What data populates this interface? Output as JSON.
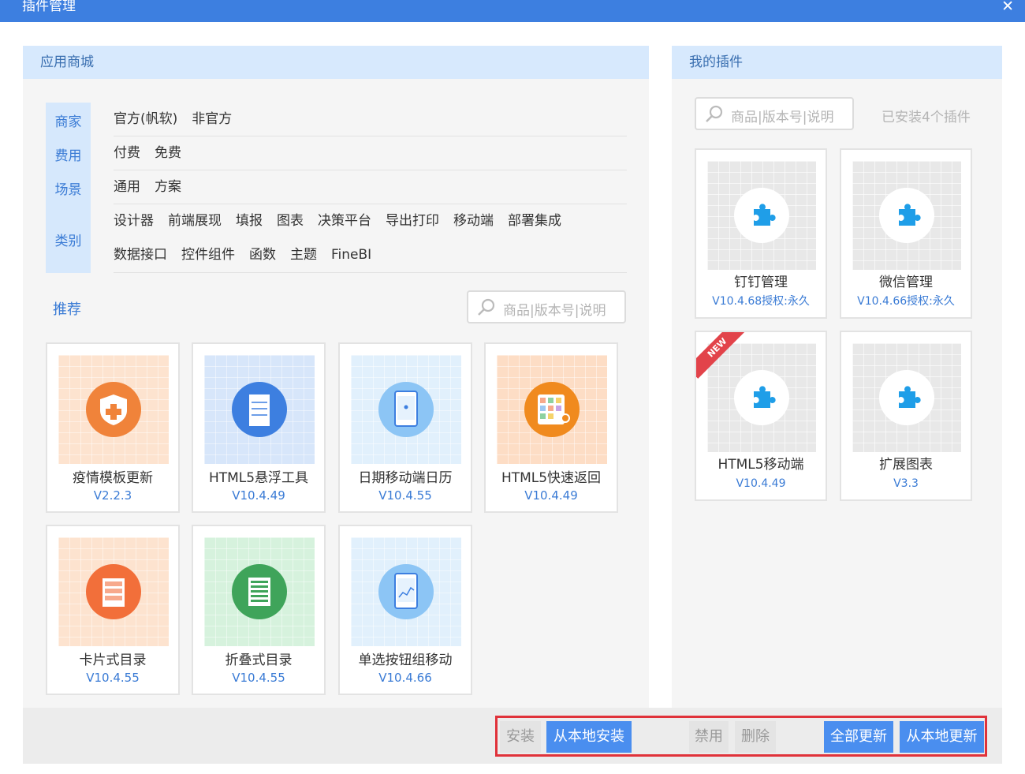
{
  "window": {
    "title": "插件管理",
    "close_glyph": "✕"
  },
  "store": {
    "title": "应用商城",
    "filters": [
      {
        "category": "商家",
        "options": [
          "官方(帆软)",
          "非官方"
        ]
      },
      {
        "category": "费用",
        "options": [
          "付费",
          "免费"
        ]
      },
      {
        "category": "场景",
        "options": [
          "通用",
          "方案"
        ]
      },
      {
        "category": "类别",
        "options": [
          "设计器",
          "前端展现",
          "填报",
          "图表",
          "决策平台",
          "导出打印",
          "移动端",
          "部署集成",
          "数据接口",
          "控件组件",
          "函数",
          "主题",
          "FineBI"
        ]
      }
    ],
    "recommend_label": "推荐",
    "search_placeholder": "商品|版本号|说明",
    "items": [
      {
        "name": "疫情模板更新",
        "version": "V2.2.3",
        "icon": "shield-cross-icon",
        "color": "#f0833a",
        "bg": "#fde3cf"
      },
      {
        "name": "HTML5悬浮工具",
        "version": "V10.4.49",
        "icon": "document-icon",
        "color": "#3d7fe0",
        "bg": "#d7e6fa"
      },
      {
        "name": "日期移动端日历",
        "version": "V10.4.55",
        "icon": "tablet-calendar-icon",
        "color": "#8cc5f5",
        "bg": "#e1f0fc"
      },
      {
        "name": "HTML5快速返回",
        "version": "V10.4.49",
        "icon": "tablet-grid-icon",
        "color": "#f08a1e",
        "bg": "#fdddc5"
      },
      {
        "name": "卡片式目录",
        "version": "V10.4.55",
        "icon": "cards-icon",
        "color": "#f26f3a",
        "bg": "#fde3cf"
      },
      {
        "name": "折叠式目录",
        "version": "V10.4.55",
        "icon": "list-icon",
        "color": "#3fa45a",
        "bg": "#d6f2dd"
      },
      {
        "name": "单选按钮组移动",
        "version": "V10.4.66",
        "icon": "tablet-chart-icon",
        "color": "#8cc5f5",
        "bg": "#e1f0fc"
      }
    ]
  },
  "mine": {
    "title": "我的插件",
    "search_placeholder": "商品|版本号|说明",
    "installed_text": "已安装4个插件",
    "plugins": [
      {
        "name": "钉钉管理",
        "version": "V10.4.68授权:永久",
        "icon": "puzzle-icon",
        "is_new": false
      },
      {
        "name": "微信管理",
        "version": "V10.4.66授权:永久",
        "icon": "puzzle-icon",
        "is_new": false
      },
      {
        "name": "HTML5移动端",
        "version": "V10.4.49",
        "icon": "puzzle-icon",
        "is_new": true,
        "badge": "NEW"
      },
      {
        "name": "扩展图表",
        "version": "V3.3",
        "icon": "puzzle-icon",
        "is_new": false
      }
    ]
  },
  "actions": {
    "install": "安装",
    "install_local": "从本地安装",
    "disable": "禁用",
    "delete": "删除",
    "update_all": "全部更新",
    "update_local": "从本地更新"
  }
}
